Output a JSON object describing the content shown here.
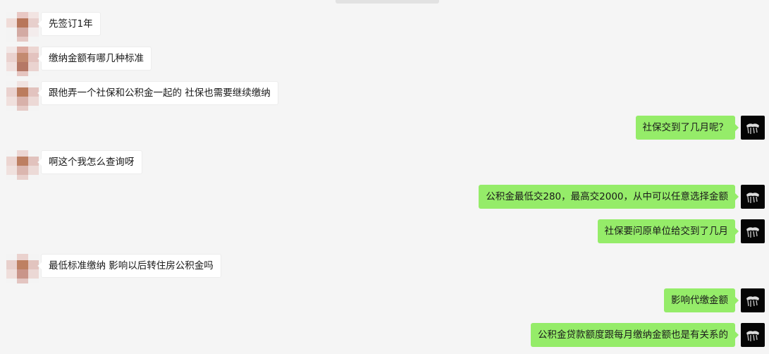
{
  "messages": [
    {
      "side": "left",
      "text": "先签订1年"
    },
    {
      "side": "left",
      "text": "缴纳金额有哪几种标准"
    },
    {
      "side": "left",
      "text": "跟他弄一个社保和公积金一起的  社保也需要继续缴纳"
    },
    {
      "side": "right",
      "text": "社保交到了几月呢？"
    },
    {
      "side": "left",
      "text": "啊这个我怎么查询呀"
    },
    {
      "side": "right",
      "text": "公积金最低交280，最高交2000，从中可以任意选择金额"
    },
    {
      "side": "right",
      "text": "社保要问原单位给交到了几月"
    },
    {
      "side": "left",
      "text": "最低标准缴纳 影响以后转住房公积金吗"
    },
    {
      "side": "right",
      "text": "影响代缴金额"
    },
    {
      "side": "right",
      "text": "公积金贷款额度跟每月缴纳金额也是有关系的"
    }
  ],
  "colors": {
    "background": "#f5f5f5",
    "self_bubble": "#95ec69",
    "contact_bubble": "#ffffff"
  },
  "icons": {
    "contact_avatar": "pixelated-avatar-icon",
    "self_avatar": "dark-avatar-icon"
  }
}
